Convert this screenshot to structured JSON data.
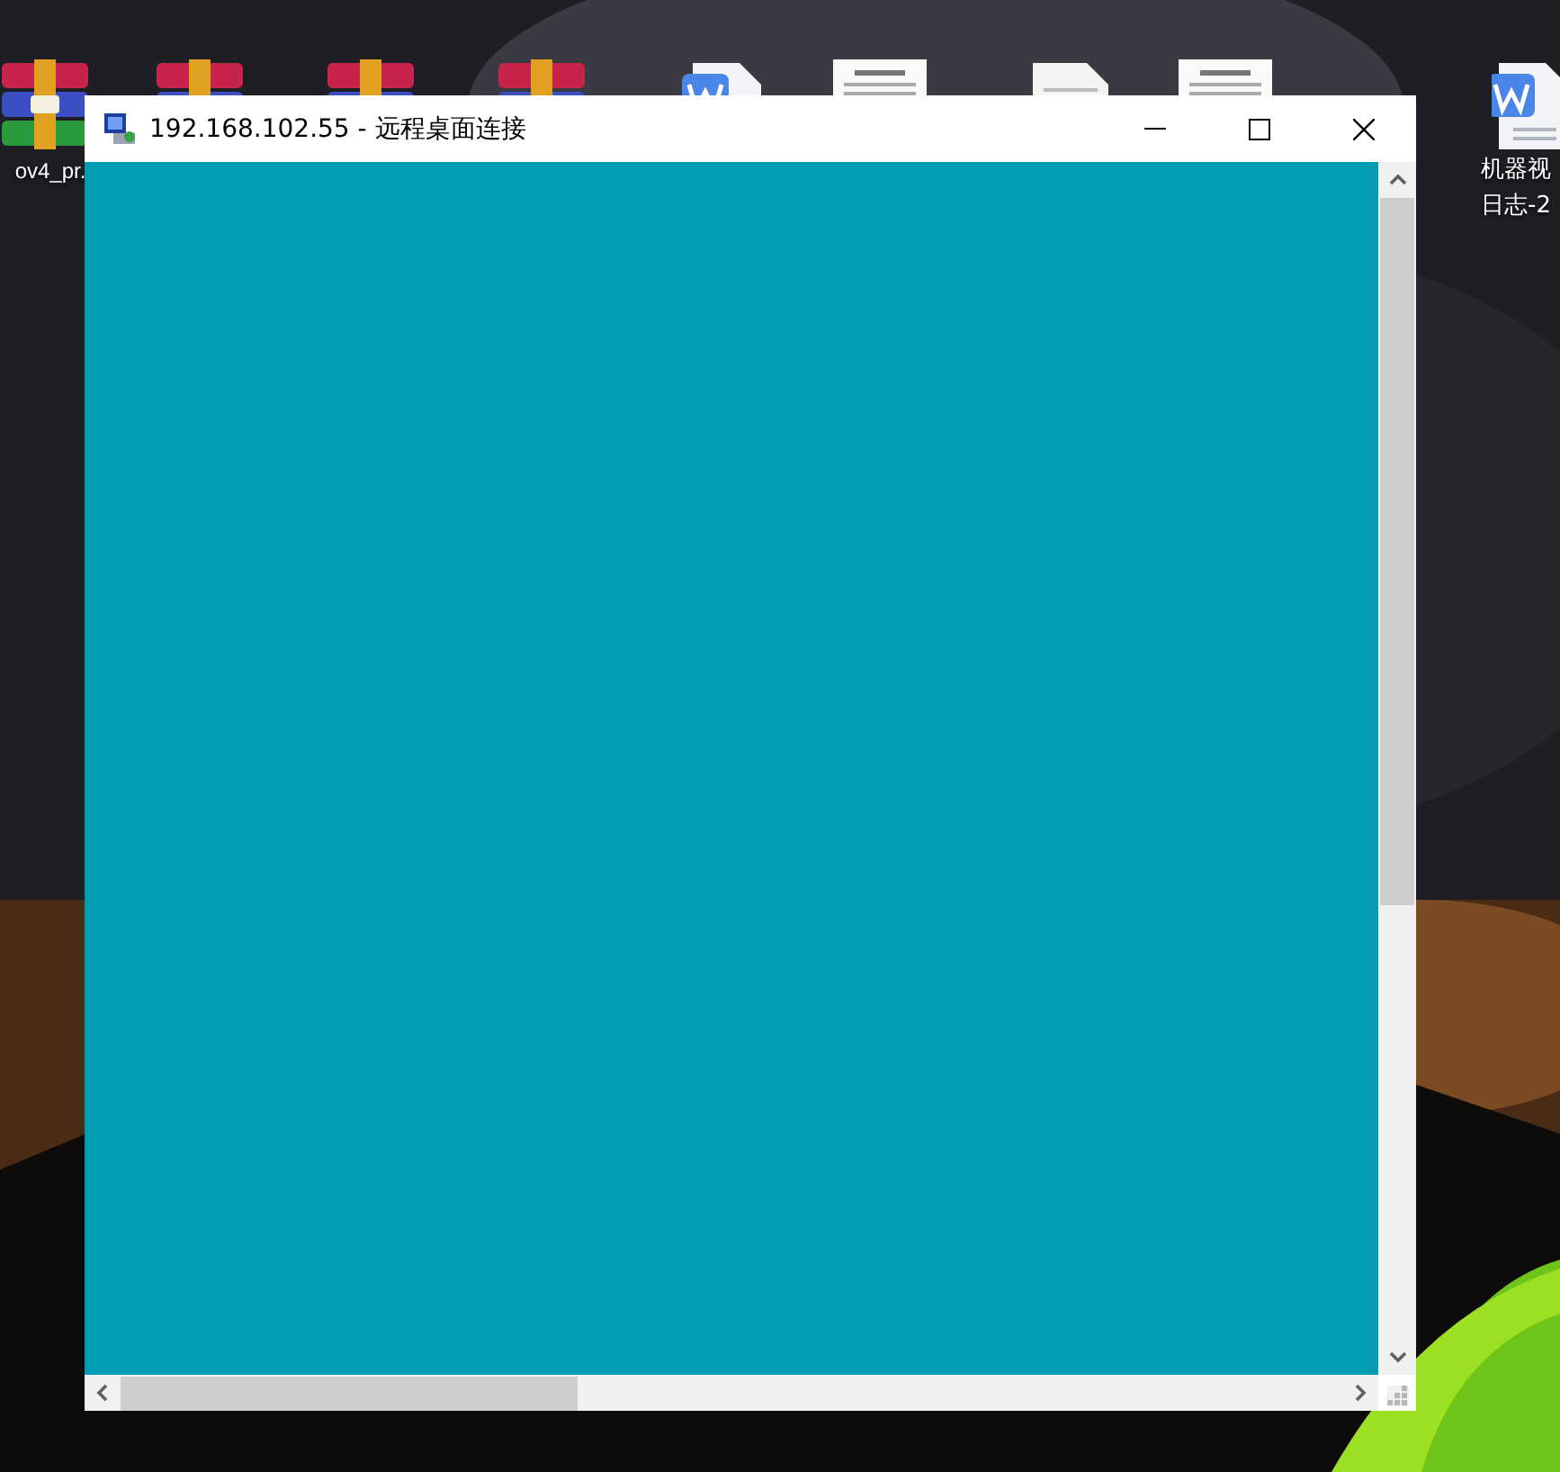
{
  "desktop": {
    "icons": [
      {
        "kind": "archive",
        "label": "ov4_pr."
      },
      {
        "kind": "archive"
      },
      {
        "kind": "archive"
      },
      {
        "kind": "archive"
      },
      {
        "kind": "word"
      },
      {
        "kind": "thumbnail"
      },
      {
        "kind": "document"
      },
      {
        "kind": "thumbnail"
      },
      {
        "kind": "word",
        "label": "机器视",
        "label_2": "日志-2"
      }
    ]
  },
  "window": {
    "title": "192.168.102.55 - 远程桌面连接"
  }
}
